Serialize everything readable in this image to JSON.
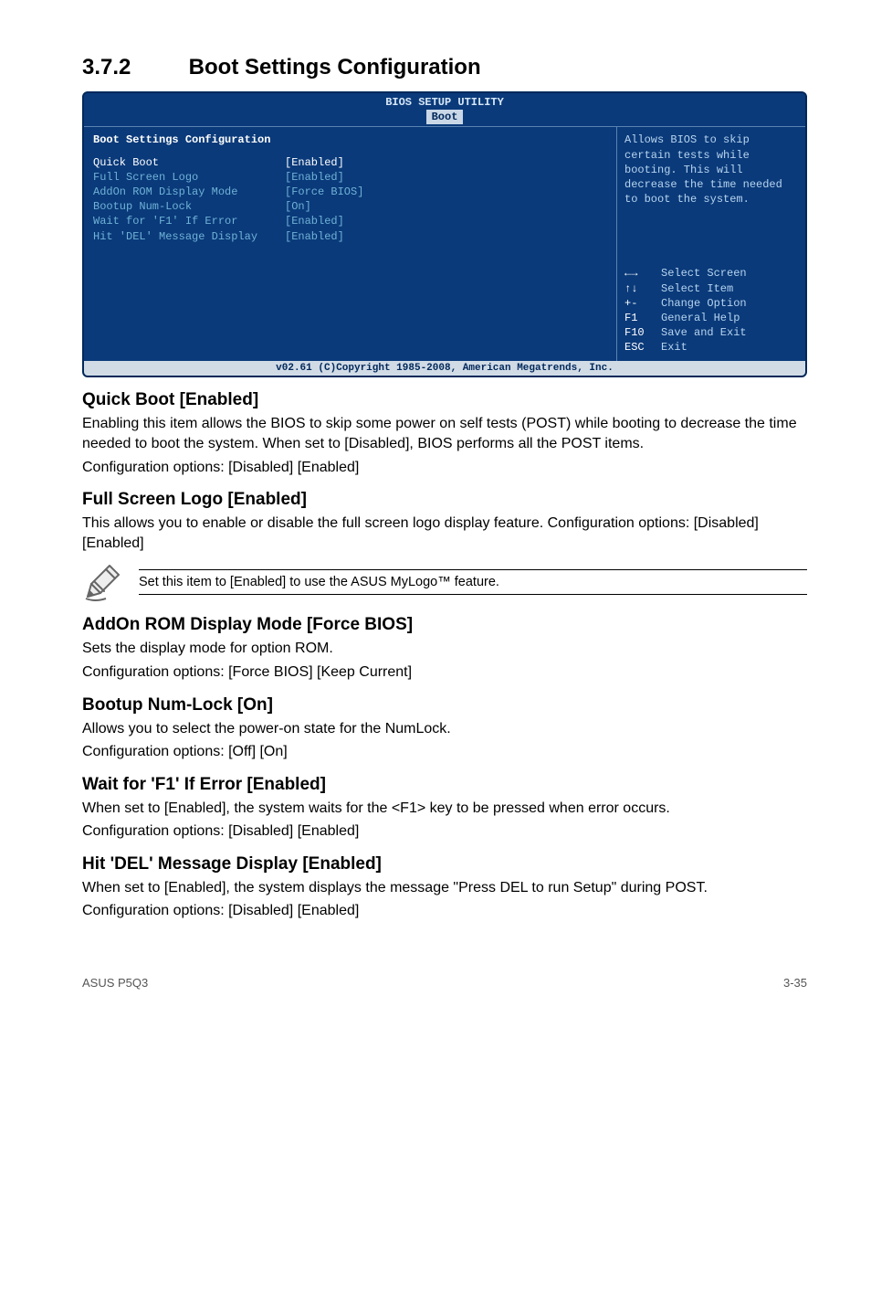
{
  "section": {
    "number": "3.7.2",
    "title": "Boot Settings Configuration"
  },
  "bios": {
    "title": "BIOS SETUP UTILITY",
    "tab": "Boot",
    "panel_heading": "Boot Settings Configuration",
    "rows": [
      {
        "label": "Quick Boot",
        "value": "[Enabled]"
      },
      {
        "label": "Full Screen Logo",
        "value": "[Enabled]"
      },
      {
        "label": "AddOn ROM Display Mode",
        "value": "[Force BIOS]"
      },
      {
        "label": "Bootup Num-Lock",
        "value": "[On]"
      },
      {
        "label": "Wait for 'F1' If Error",
        "value": "[Enabled]"
      },
      {
        "label": "Hit 'DEL' Message Display",
        "value": "[Enabled]"
      }
    ],
    "help": "Allows BIOS to skip certain tests while booting. This will decrease the time needed to boot the system.",
    "keys": [
      {
        "k": "←→",
        "d": "Select Screen"
      },
      {
        "k": "↑↓",
        "d": "Select Item"
      },
      {
        "k": "+-",
        "d": "Change Option"
      },
      {
        "k": "F1",
        "d": "General Help"
      },
      {
        "k": "F10",
        "d": "Save and Exit"
      },
      {
        "k": "ESC",
        "d": "Exit"
      }
    ],
    "footer": "v02.61 (C)Copyright 1985-2008, American Megatrends, Inc."
  },
  "items": [
    {
      "h": "Quick Boot [Enabled]",
      "p": [
        "Enabling this item allows the BIOS to skip some power on self tests (POST) while booting to decrease the time needed to boot the system. When set to [Disabled], BIOS performs all the POST items.",
        "Configuration options: [Disabled] [Enabled]"
      ]
    },
    {
      "h": "Full Screen Logo [Enabled]",
      "p": [
        "This allows you to enable or disable the full screen logo display feature. Configuration options: [Disabled] [Enabled]"
      ],
      "note": "Set this item to [Enabled] to use the ASUS MyLogo™ feature."
    },
    {
      "h": "AddOn ROM Display Mode [Force BIOS]",
      "p": [
        "Sets the display mode for option ROM.",
        "Configuration options: [Force BIOS] [Keep Current]"
      ]
    },
    {
      "h": "Bootup Num-Lock [On]",
      "p": [
        "Allows you to select the power-on state for the NumLock.",
        "Configuration options: [Off] [On]"
      ]
    },
    {
      "h": "Wait for 'F1' If Error [Enabled]",
      "p": [
        "When set to [Enabled], the system waits for the <F1> key to be pressed when error occurs.",
        "Configuration options: [Disabled] [Enabled]"
      ]
    },
    {
      "h": "Hit 'DEL' Message Display [Enabled]",
      "p": [
        "When set to [Enabled], the system displays the message \"Press DEL to run Setup\" during POST.",
        "Configuration options: [Disabled] [Enabled]"
      ]
    }
  ],
  "footer": {
    "left": "ASUS P5Q3",
    "right": "3-35"
  }
}
